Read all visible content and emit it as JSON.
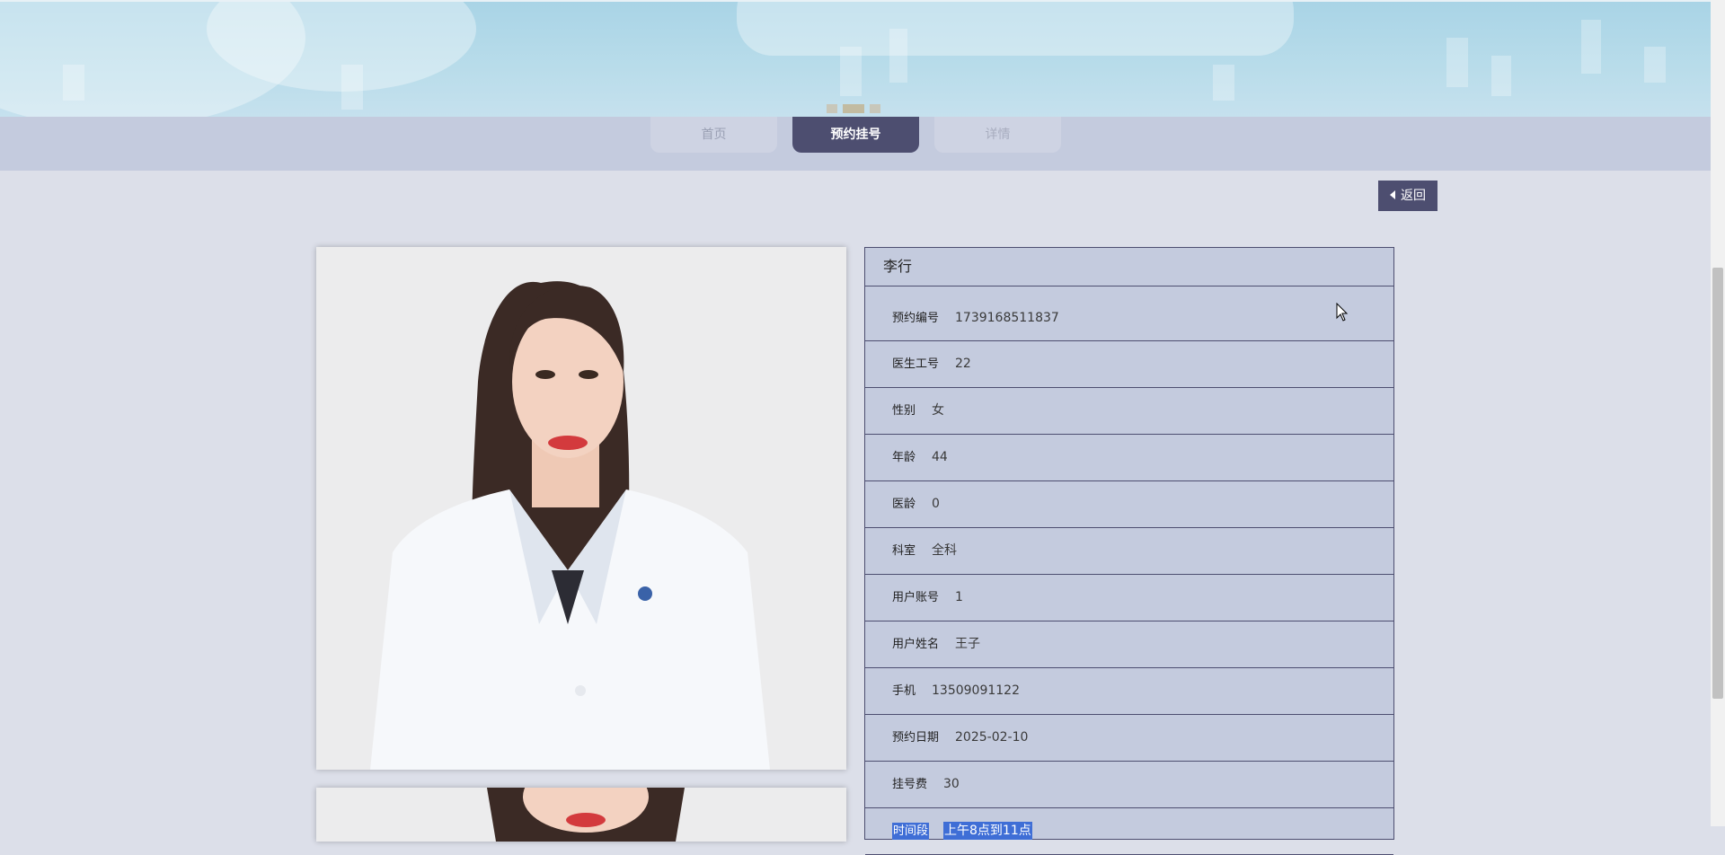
{
  "nav": {
    "tabs": [
      {
        "label": "首页"
      },
      {
        "label": "预约挂号"
      },
      {
        "label": "详情"
      }
    ]
  },
  "back_button": {
    "label": "返回"
  },
  "doctor": {
    "name": "李行",
    "fields": [
      {
        "label": "预约编号",
        "value": "1739168511837"
      },
      {
        "label": "医生工号",
        "value": "22"
      },
      {
        "label": "性别",
        "value": "女"
      },
      {
        "label": "年龄",
        "value": "44"
      },
      {
        "label": "医龄",
        "value": "0"
      },
      {
        "label": "科室",
        "value": "全科"
      },
      {
        "label": "用户账号",
        "value": "1"
      },
      {
        "label": "用户姓名",
        "value": "王子"
      },
      {
        "label": "手机",
        "value": "13509091122"
      },
      {
        "label": "预约日期",
        "value": "2025-02-10"
      },
      {
        "label": "挂号费",
        "value": "30"
      },
      {
        "label": "时间段",
        "value": "上午8点到11点"
      }
    ]
  },
  "colors": {
    "accent": "#4d4e70",
    "panel": "#c4cbde",
    "page": "#dcdfe9",
    "selection": "#3f6ed6"
  }
}
